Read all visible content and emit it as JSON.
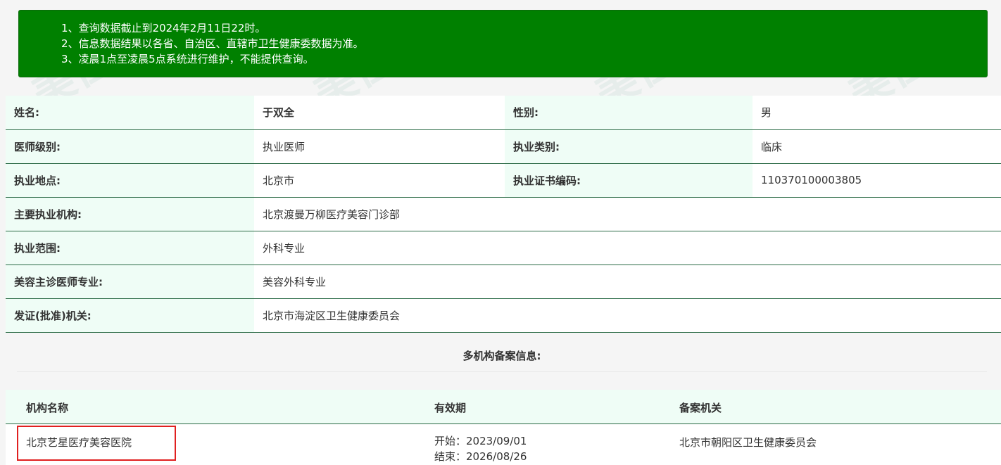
{
  "notice": {
    "line1": "1、查询数据截止到2024年2月11日22时。",
    "line2": "2、信息数据结果以各省、自治区、直辖市卫生健康委数据为准。",
    "line3": "3、凌晨1点至凌晨5点系统进行维护，不能提供查询。"
  },
  "info": {
    "name_label": "姓名:",
    "name_value": "于双全",
    "gender_label": "性别:",
    "gender_value": "男",
    "level_label": "医师级别:",
    "level_value": "执业医师",
    "category_label": "执业类别:",
    "category_value": "临床",
    "location_label": "执业地点:",
    "location_value": "北京市",
    "cert_label": "执业证书编码:",
    "cert_value": "110370100003805",
    "institution_label": "主要执业机构:",
    "institution_value": "北京渡曼万柳医疗美容门诊部",
    "scope_label": "执业范围:",
    "scope_value": "外科专业",
    "cosmetic_label": "美容主诊医师专业:",
    "cosmetic_value": "美容外科专业",
    "authority_label": "发证(批准)机关:",
    "authority_value": "北京市海淀区卫生健康委员会"
  },
  "multi": {
    "title": "多机构备案信息:",
    "headers": {
      "org": "机构名称",
      "validity": "有效期",
      "agency": "备案机关"
    },
    "row": {
      "org": "北京艺星医疗美容医院",
      "start": "开始：2023/09/01",
      "end": "结束：2026/08/26",
      "agency": "北京市朝阳区卫生健康委员会"
    }
  },
  "colors": {
    "notice_bg": "#008000",
    "label_bg": "#effdf6",
    "row_border": "#2a6a45",
    "highlight": "#e02020"
  }
}
